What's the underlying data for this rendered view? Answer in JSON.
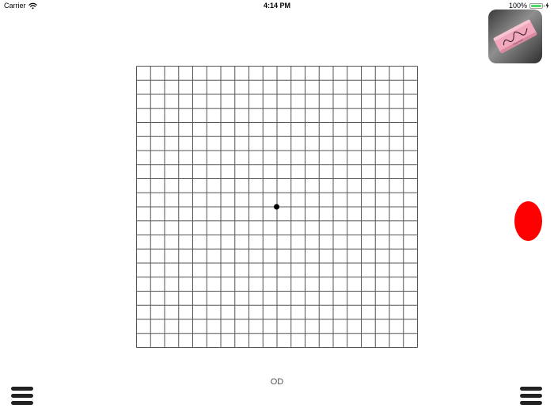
{
  "status_bar": {
    "carrier": "Carrier",
    "time": "4:14 PM",
    "battery_percent": "100%",
    "battery_level": 1.0,
    "icons": [
      "wifi-icon",
      "battery-icon",
      "charging-bolt-icon"
    ]
  },
  "eraser_button": {
    "icon": "eraser-icon",
    "eraser_text": "Pink Pearl"
  },
  "grid": {
    "rows": 20,
    "columns": 20,
    "line_color": "#555555",
    "center_dot_color": "#000000"
  },
  "marker": {
    "color": "#ff0000",
    "icon": "red-oval-marker"
  },
  "menus": {
    "left_icon": "hamburger-icon",
    "right_icon": "hamburger-icon"
  },
  "eye_label": "OD"
}
